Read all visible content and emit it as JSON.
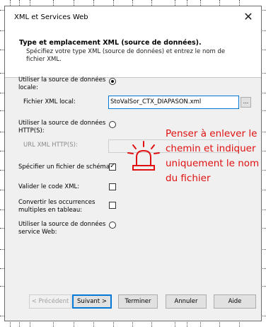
{
  "window": {
    "title": "XML et Services Web",
    "close_glyph": "✕"
  },
  "header": {
    "title": "Type et emplacement XML (source de données).",
    "description": "Spécifiez votre type XML (source de données) et entrez le nom de fichier XML."
  },
  "options": {
    "local_label": "Utiliser la source de données locale:",
    "local_selected": true,
    "local_file_label": "Fichier XML local:",
    "local_file_value": "StoValSor_CTX_DIAPASON.xml",
    "browse_label": "...",
    "http_label": "Utiliser la source de données HTTP(S):",
    "http_selected": false,
    "http_url_label": "URL XML HTTP(S):",
    "http_url_value": "",
    "schema_label": "Spécifier un fichier de schéma:",
    "schema_checked": true,
    "validate_label": "Valider le code XML:",
    "validate_checked": false,
    "convert_label": "Convertir les occurrences multiples en tableau:",
    "convert_checked": false,
    "webservice_label": "Utiliser la source de données service Web:",
    "webservice_selected": false
  },
  "buttons": {
    "previous": "< Précédent",
    "next": "Suivant >",
    "finish": "Terminer",
    "cancel": "Annuler",
    "help": "Aide"
  },
  "annotation": {
    "text": "Penser à enlever le chemin et indiquer uniquement le nom du fichier",
    "color": "#e01010",
    "icon": "alarm-light-icon"
  }
}
